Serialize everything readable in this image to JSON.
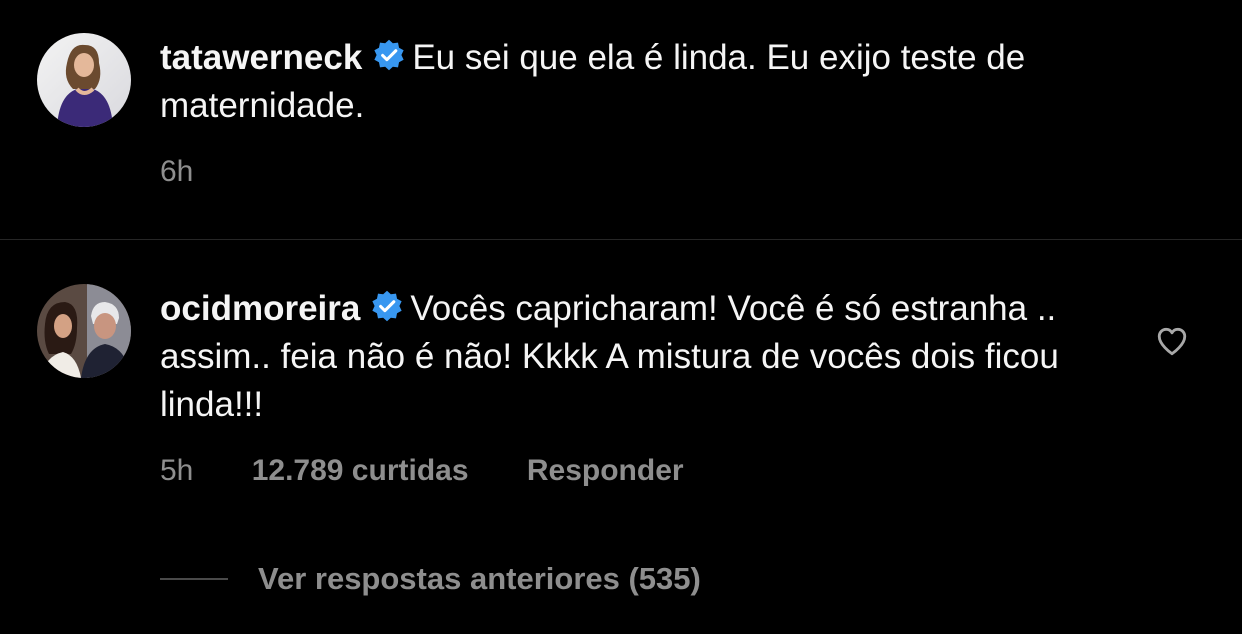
{
  "comments": [
    {
      "username": "tatawerneck",
      "verified": true,
      "text": "Eu sei que ela é linda. Eu exijo teste de maternidade.",
      "time": "6h"
    },
    {
      "username": "ocidmoreira",
      "verified": true,
      "text": "Vocês capricharam! Você é só estranha .. assim.. feia não é não! Kkkk A mistura de vocês dois ficou linda!!!",
      "time": "5h",
      "likes": "12.789 curtidas",
      "reply_label": "Responder",
      "view_replies": "Ver respostas anteriores (535)"
    }
  ],
  "colors": {
    "background": "#000000",
    "text": "#f5f5f5",
    "secondary": "#8e8e8e",
    "verified_blue": "#3897f0",
    "divider": "#262626"
  },
  "icons": {
    "verified": "verified-badge-icon",
    "like": "heart-outline-icon"
  }
}
